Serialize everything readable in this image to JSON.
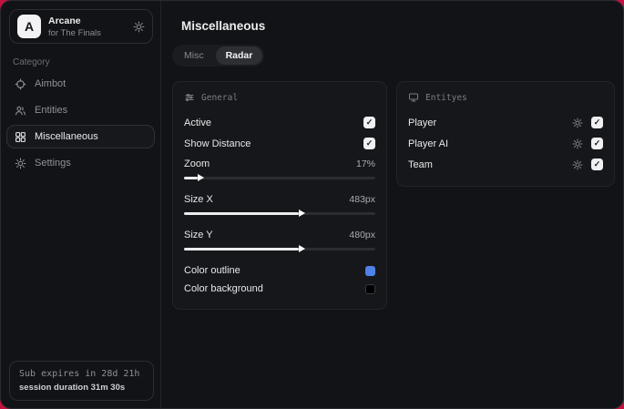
{
  "colors": {
    "backdrop_red": "#c41140",
    "swatch_outline_blue": "#4f82e8",
    "swatch_background_black": "#000000"
  },
  "sidebar": {
    "brand": {
      "name": "Arcane",
      "subtitle": "for The Finals",
      "avatar_letter": "A"
    },
    "category_label": "Category",
    "items": [
      {
        "label": "Aimbot",
        "active": false
      },
      {
        "label": "Entities",
        "active": false
      },
      {
        "label": "Miscellaneous",
        "active": true
      },
      {
        "label": "Settings",
        "active": false
      }
    ],
    "footer": {
      "sub_expiry": "Sub expires in 28d 21h",
      "session_duration": "session duration 31m 30s"
    }
  },
  "main": {
    "title": "Miscellaneous",
    "tabs": [
      {
        "label": "Misc",
        "active": false
      },
      {
        "label": "Radar",
        "active": true
      }
    ],
    "general": {
      "title": "General",
      "toggles": [
        {
          "label": "Active",
          "checked": true
        },
        {
          "label": "Show Distance",
          "checked": true
        }
      ],
      "sliders": [
        {
          "label": "Zoom",
          "value": "17%",
          "fill_style": "width:7%"
        },
        {
          "label": "Size X",
          "value": "483px",
          "fill_style": "width:60%"
        },
        {
          "label": "Size Y",
          "value": "480px",
          "fill_style": "width:60%"
        }
      ],
      "color_rows": [
        {
          "label": "Color outline",
          "swatch_style": "background:#4f82e8"
        },
        {
          "label": "Color background",
          "swatch_style": "background:#000000;border:1px solid #3a3b40"
        }
      ]
    },
    "entities": {
      "title": "Entityes",
      "rows": [
        {
          "label": "Player",
          "checked": true
        },
        {
          "label": "Player AI",
          "checked": true
        },
        {
          "label": "Team",
          "checked": true
        }
      ]
    }
  }
}
